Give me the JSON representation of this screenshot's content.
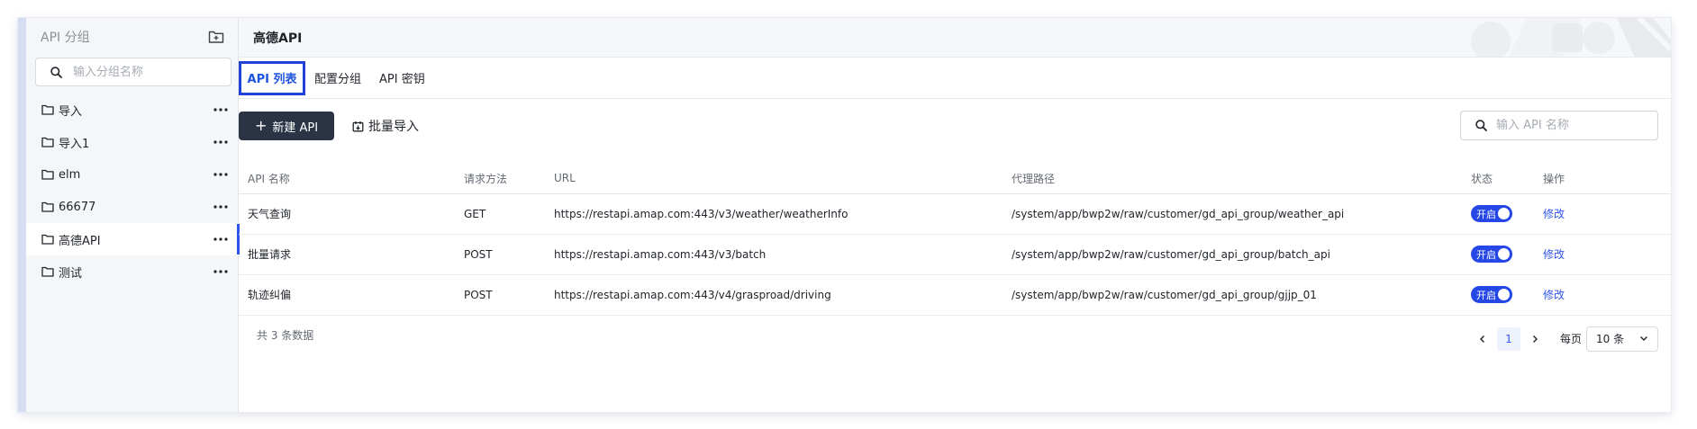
{
  "sidebar": {
    "title": "API 分组",
    "search_placeholder": "输入分组名称",
    "items": [
      {
        "label": "导入",
        "active": false
      },
      {
        "label": "导入1",
        "active": false
      },
      {
        "label": "elm",
        "active": false
      },
      {
        "label": "66677",
        "active": false
      },
      {
        "label": "高德API",
        "active": true
      },
      {
        "label": "测试",
        "active": false
      }
    ]
  },
  "header": {
    "title": "高德API"
  },
  "tabs": [
    {
      "label": "API 列表",
      "active": true
    },
    {
      "label": "配置分组",
      "active": false
    },
    {
      "label": "API 密钥",
      "active": false
    }
  ],
  "toolbar": {
    "new_label": "新建 API",
    "import_label": "批量导入",
    "search_placeholder": "输入 API 名称"
  },
  "table": {
    "columns": [
      "API 名称",
      "请求方法",
      "URL",
      "代理路径",
      "状态",
      "操作"
    ],
    "rows": [
      {
        "name": "天气查询",
        "method": "GET",
        "url": "https://restapi.amap.com:443/v3/weather/weatherInfo",
        "path": "/system/app/bwp2w/raw/customer/gd_api_group/weather_api",
        "status": "开启",
        "action": "修改"
      },
      {
        "name": "批量请求",
        "method": "POST",
        "url": "https://restapi.amap.com:443/v3/batch",
        "path": "/system/app/bwp2w/raw/customer/gd_api_group/batch_api",
        "status": "开启",
        "action": "修改"
      },
      {
        "name": "轨迹纠偏",
        "method": "POST",
        "url": "https://restapi.amap.com:443/v4/grasproad/driving",
        "path": "/system/app/bwp2w/raw/customer/gd_api_group/gjjp_01",
        "status": "开启",
        "action": "修改"
      }
    ]
  },
  "footer": {
    "total": "共 3 条数据",
    "current_page": "1",
    "per_page_label": "每页",
    "page_size": "10 条"
  },
  "colors": {
    "accent": "#2f54eb",
    "primary_button": "#2b3444",
    "toggle_on": "#2547e6"
  }
}
